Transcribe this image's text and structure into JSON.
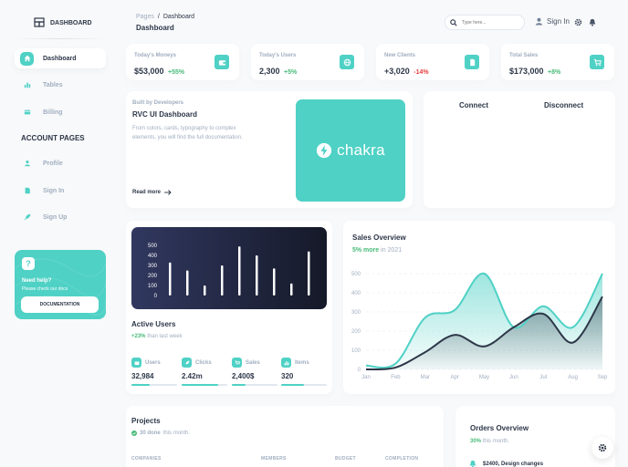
{
  "brand": {
    "title": "DASHBOARD"
  },
  "sidebar": {
    "items": [
      {
        "label": "Dashboard",
        "icon": "home-icon",
        "active": true
      },
      {
        "label": "Tables",
        "icon": "stats-icon"
      },
      {
        "label": "Billing",
        "icon": "credit-card-icon"
      }
    ],
    "section_title": "ACCOUNT PAGES",
    "account_items": [
      {
        "label": "Profile",
        "icon": "person-icon"
      },
      {
        "label": "Sign In",
        "icon": "document-icon"
      },
      {
        "label": "Sign Up",
        "icon": "rocket-icon"
      }
    ],
    "help": {
      "title": "Need help?",
      "subtitle": "Please check our docs",
      "button": "DOCUMENTATION"
    }
  },
  "header": {
    "breadcrumb_root": "Pages",
    "breadcrumb_sep": "/",
    "breadcrumb_current": "Dashboard",
    "page_title": "Dashboard",
    "search_placeholder": "Type here...",
    "sign_in": "Sign In"
  },
  "kpis": [
    {
      "label": "Today's Moneys",
      "value": "$53,000",
      "change": "+55%",
      "trend": "up",
      "icon": "wallet-icon"
    },
    {
      "label": "Today's Users",
      "value": "2,300",
      "change": "+5%",
      "trend": "up",
      "icon": "globe-icon"
    },
    {
      "label": "New Clients",
      "value": "+3,020",
      "change": "-14%",
      "trend": "down",
      "icon": "document-icon"
    },
    {
      "label": "Total Sales",
      "value": "$173,000",
      "change": "+8%",
      "trend": "up",
      "icon": "cart-icon"
    }
  ],
  "promo": {
    "eyebrow": "Built by Developers",
    "title": "RVC UI Dashboard",
    "body": "From colors, cards, typography to complex elements, you will find the full documentation.",
    "link": "Read more",
    "logo_text": "chakra"
  },
  "connect": {
    "connect_label": "Connect",
    "disconnect_label": "Disconnect"
  },
  "active_users": {
    "title": "Active Users",
    "change": "+23%",
    "change_suffix": "than last week",
    "metrics": [
      {
        "label": "Users",
        "value": "32,984",
        "progress": 0.4,
        "icon": "wallet-icon"
      },
      {
        "label": "Clicks",
        "value": "2.42m",
        "progress": 0.8,
        "icon": "rocket-icon"
      },
      {
        "label": "Sales",
        "value": "2,400$",
        "progress": 0.3,
        "icon": "cart-icon"
      },
      {
        "label": "Items",
        "value": "320",
        "progress": 0.5,
        "icon": "stats-icon"
      }
    ]
  },
  "sales_overview": {
    "title": "Sales Overview",
    "highlight": "5% more",
    "suffix": "in 2021"
  },
  "projects": {
    "title": "Projects",
    "done": "30 done",
    "done_suffix": "this month.",
    "columns": [
      "COMPANIES",
      "MEMBERS",
      "BUDGET",
      "COMPLETION"
    ]
  },
  "orders": {
    "title": "Orders Overview",
    "highlight": "30%",
    "suffix": "this month.",
    "first_item": "$2400, Design changes"
  },
  "colors": {
    "accent": "#4fd1c5",
    "dark": "#2d3748",
    "muted": "#a0aec0",
    "positive": "#48bb78",
    "negative": "#e53e3e"
  },
  "chart_data": [
    {
      "type": "bar",
      "title": "",
      "yticks": [
        "0",
        "100",
        "200",
        "300",
        "400",
        "500"
      ],
      "ylim": [
        0,
        500
      ],
      "values": [
        330,
        250,
        100,
        300,
        490,
        400,
        270,
        120,
        440
      ],
      "grid": false
    },
    {
      "type": "area",
      "title": "",
      "categories": [
        "Jan",
        "Feb",
        "Mar",
        "Apr",
        "May",
        "Jun",
        "Jul",
        "Aug",
        "Sep"
      ],
      "ylim": [
        0,
        500
      ],
      "yticks": [
        "0",
        "100",
        "200",
        "300",
        "400",
        "500"
      ],
      "grid": true,
      "series": [
        {
          "values": [
            20,
            30,
            270,
            310,
            500,
            220,
            330,
            220,
            500
          ],
          "color": "#4fd1c5"
        },
        {
          "values": [
            0,
            10,
            90,
            180,
            120,
            220,
            290,
            140,
            380
          ],
          "color": "#2d3748"
        }
      ]
    }
  ]
}
